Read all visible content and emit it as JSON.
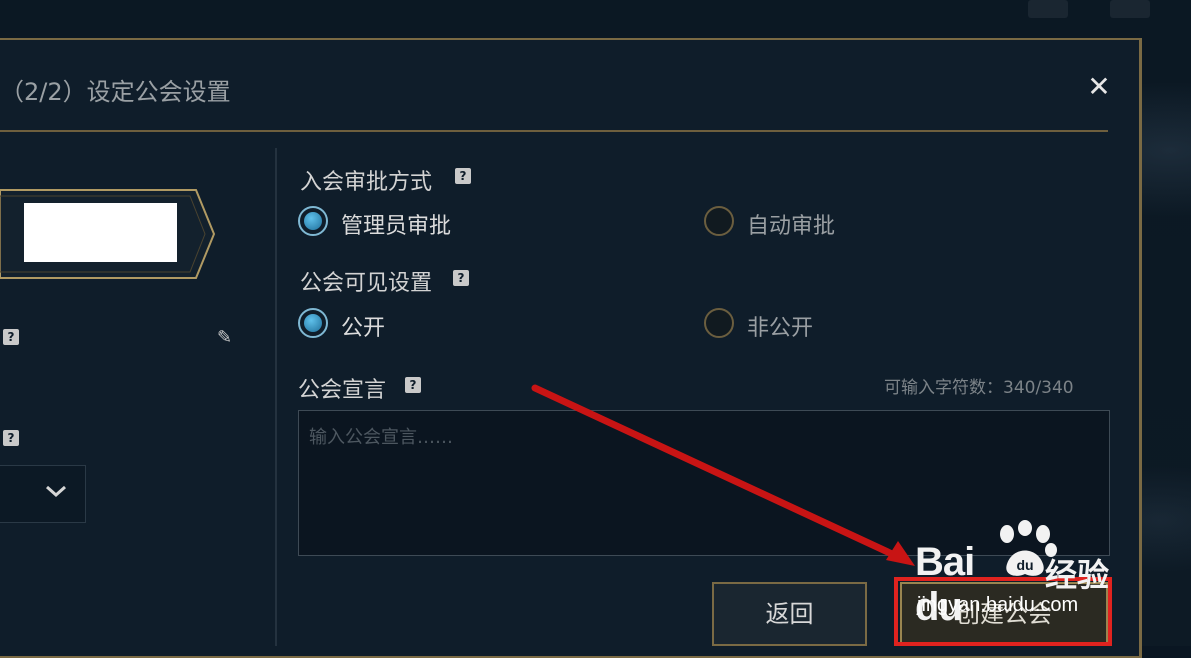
{
  "dialog": {
    "title": "（2/2）设定公会设置",
    "close_glyph": "✕"
  },
  "left_panel": {
    "help_glyph": "?",
    "edit_icon": "pencil-icon",
    "dropdown_icon": "chevron-down-icon"
  },
  "approval": {
    "label": "入会审批方式",
    "options": [
      {
        "label": "管理员审批",
        "selected": true
      },
      {
        "label": "自动审批",
        "selected": false
      }
    ]
  },
  "visibility": {
    "label": "公会可见设置",
    "options": [
      {
        "label": "公开",
        "selected": true
      },
      {
        "label": "非公开",
        "selected": false
      }
    ]
  },
  "declaration": {
    "label": "公会宣言",
    "counter": "可输入字符数：340/340",
    "placeholder": "输入公会宣言……"
  },
  "buttons": {
    "back": "返回",
    "create": "创建公会"
  },
  "watermark": {
    "logo": "Bai du",
    "cn": "经验",
    "url": "jingyan.baidu.com"
  },
  "colors": {
    "gold_border": "#7a6a44",
    "accent_blue": "#5fc0ea",
    "highlight_red": "#e0231f"
  }
}
